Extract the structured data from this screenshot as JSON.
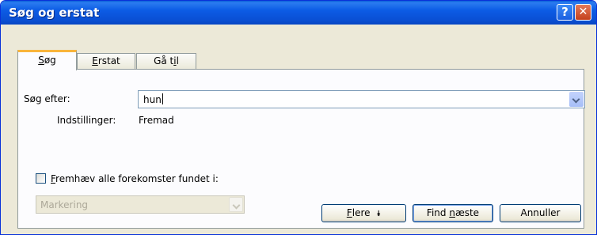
{
  "window": {
    "title": "Søg og erstat"
  },
  "tabs": [
    {
      "label_u": "S",
      "label_rest": "øg"
    },
    {
      "label_u": "E",
      "label_rest": "rstat"
    },
    {
      "label_pre": "Gå t",
      "label_u": "i",
      "label_rest": "l"
    }
  ],
  "search": {
    "label": "Søg efter:",
    "value": "hun",
    "options_label": "Indstillinger:",
    "options_value": "Fremad"
  },
  "highlight": {
    "label_u": "F",
    "label_rest": "remhæv alle forekomster fundet i:",
    "checked": false,
    "scope_value": "Markering"
  },
  "buttons": {
    "more_u": "F",
    "more_rest": "lere",
    "more_arrow": "⯯",
    "find_pre": "Find ",
    "find_u": "n",
    "find_rest": "æste",
    "cancel": "Annuller"
  },
  "colors": {
    "titlebar": "#0a50d4",
    "accent_tab": "#f9b53b",
    "dialog_bg": "#ece9d8"
  }
}
